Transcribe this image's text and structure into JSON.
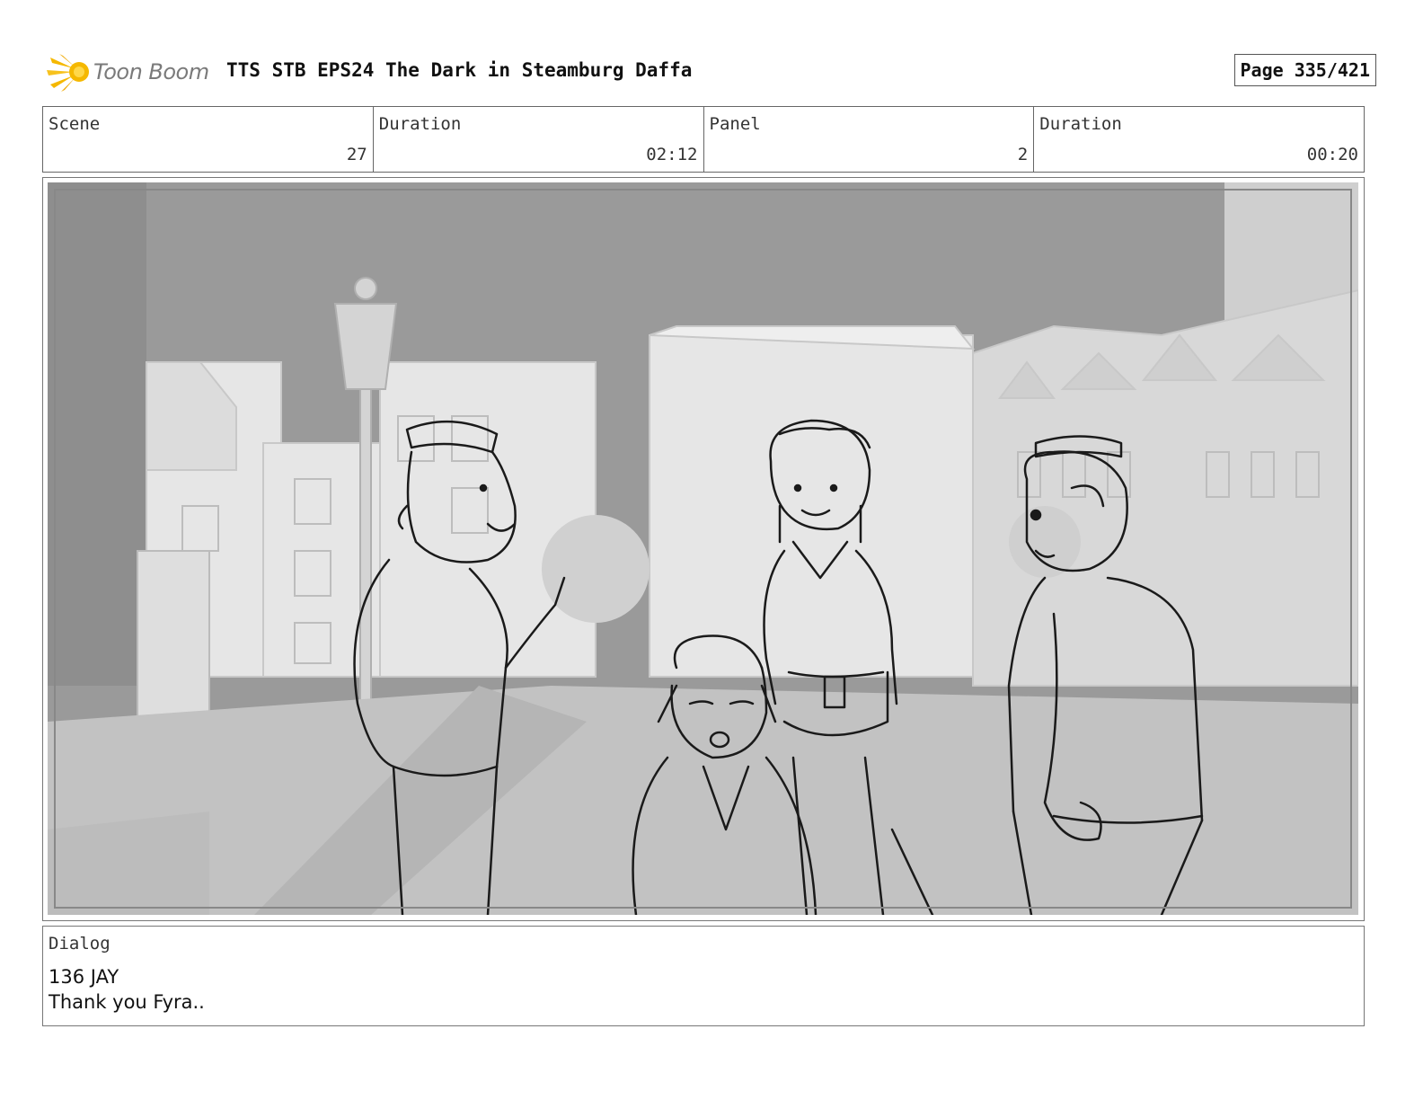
{
  "header": {
    "logo_text": "Toon Boom",
    "title": "TTS STB EPS24 The Dark in Steamburg Daffa",
    "page": "Page 335/421"
  },
  "info": {
    "scene_label": "Scene",
    "scene_value": "27",
    "scene_duration_label": "Duration",
    "scene_duration_value": "02:12",
    "panel_label": "Panel",
    "panel_value": "2",
    "panel_duration_label": "Duration",
    "panel_duration_value": "00:20"
  },
  "dialog": {
    "label": "Dialog",
    "line1": "136 JAY",
    "line2": "Thank you Fyra.."
  },
  "colors": {
    "logo_accent": "#f5b800",
    "sky": "#9a9a9a",
    "buildings": "#e4e4e4",
    "road": "#c2c2c2",
    "sketch_line": "#1a1a1a"
  }
}
